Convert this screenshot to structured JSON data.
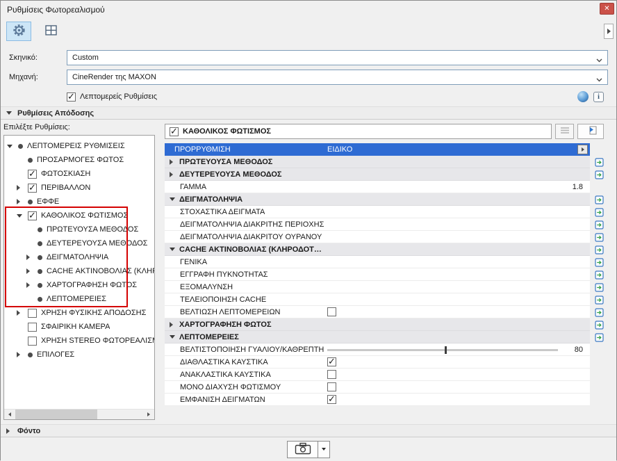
{
  "window": {
    "title": "Ρυθμίσεις Φωτορεαλισμού",
    "close_glyph": "✕"
  },
  "form": {
    "scene_label": "Σκηνικό:",
    "scene_value": "Custom",
    "engine_label": "Μηχανή:",
    "engine_value": "CineRender της MAXON",
    "detailed_settings_label": "Λεπτομερείς Ρυθμίσεις",
    "detailed_settings_checked": true
  },
  "sections": {
    "render_settings": {
      "label": "Ρυθμίσεις Απόδοσης",
      "expanded": true
    },
    "background": {
      "label": "Φόντο",
      "expanded": false
    }
  },
  "tree": {
    "caption": "Επιλέξτε Ρυθμίσεις:",
    "items": [
      {
        "label": "ΛΕΠΤΟΜΕΡΕΙΣ ΡΥΘΜΙΣΕΙΣ",
        "depth": 0,
        "expander": "expanded",
        "marker": "bullet"
      },
      {
        "label": "ΠΡΟΣΑΡΜΟΓΕΣ ΦΩΤΟΣ",
        "depth": 1,
        "expander": "none",
        "marker": "bullet"
      },
      {
        "label": "ΦΩΤΟΣΚΙΑΣΗ",
        "depth": 1,
        "expander": "none",
        "marker": "checkbox",
        "checked": true
      },
      {
        "label": "ΠΕΡΙΒΑΛΛΟΝ",
        "depth": 1,
        "expander": "collapsed",
        "marker": "checkbox",
        "checked": true
      },
      {
        "label": "ΕΦΦΕ",
        "depth": 1,
        "expander": "collapsed",
        "marker": "bullet"
      },
      {
        "label": "ΚΑΘΟΛΙΚΟΣ ΦΩΤΙΣΜΟΣ",
        "depth": 1,
        "expander": "expanded",
        "marker": "checkbox",
        "checked": true,
        "highlighted": true
      },
      {
        "label": "ΠΡΩΤΕΥΟΥΣΑ ΜΕΘΟΔΟΣ",
        "depth": 2,
        "expander": "none",
        "marker": "bullet",
        "highlighted": true
      },
      {
        "label": "ΔΕΥΤΕΡΕΥΟΥΣΑ ΜΕΘΟΔΟΣ",
        "depth": 2,
        "expander": "none",
        "marker": "bullet",
        "highlighted": true
      },
      {
        "label": "ΔΕΙΓΜΑΤΟΛΗΨΙΑ",
        "depth": 2,
        "expander": "collapsed",
        "marker": "bullet",
        "highlighted": true
      },
      {
        "label": "CACHE ΑΚΤΙΝΟΒΟΛΙΑΣ (ΚΛΗΡΟ.",
        "depth": 2,
        "expander": "collapsed",
        "marker": "bullet",
        "highlighted": true
      },
      {
        "label": "ΧΑΡΤΟΓΡΑΦΗΣΗ ΦΩΤΟΣ",
        "depth": 2,
        "expander": "collapsed",
        "marker": "bullet",
        "highlighted": true
      },
      {
        "label": "ΛΕΠΤΟΜΕΡΕΙΕΣ",
        "depth": 2,
        "expander": "none",
        "marker": "bullet",
        "highlighted": true
      },
      {
        "label": "ΧΡΗΣΗ ΦΥΣΙΚΗΣ ΑΠΟΔΟΣΗΣ",
        "depth": 1,
        "expander": "collapsed",
        "marker": "checkbox",
        "checked": false
      },
      {
        "label": "ΣΦΑΙΡΙΚΗ ΚΑΜΕΡΑ",
        "depth": 1,
        "expander": "none",
        "marker": "checkbox",
        "checked": false
      },
      {
        "label": "ΧΡΗΣΗ STEREO ΦΩΤΟΡΕΑΛΙΣΜΟΥ",
        "depth": 1,
        "expander": "none",
        "marker": "checkbox",
        "checked": false
      },
      {
        "label": "ΕΠΙΛΟΓΕΣ",
        "depth": 1,
        "expander": "collapsed",
        "marker": "bullet"
      }
    ]
  },
  "panel": {
    "title": "ΚΑΘΟΛΙΚΟΣ ΦΩΤΙΣΜΟΣ",
    "title_checked": true,
    "rows": [
      {
        "type": "preset",
        "label": "ΠΡΟΡΡΥΘΜΙΣΗ",
        "value": "ΕΙΔΙΚΟ",
        "selected": true
      },
      {
        "type": "group",
        "label": "ΠΡΩΤΕΥΟΥΣΑ ΜΕΘΟΔΟΣ",
        "expanded": false,
        "link": true
      },
      {
        "type": "group",
        "label": "ΔΕΥΤΕΡΕΥΟΥΣΑ ΜΕΘΟΔΟΣ",
        "expanded": false,
        "link": true
      },
      {
        "type": "value",
        "label": "ΓΑΜΜΑ",
        "value": "1.8"
      },
      {
        "type": "group",
        "label": "ΔΕΙΓΜΑΤΟΛΗΨΙΑ",
        "expanded": true,
        "link": true
      },
      {
        "type": "item",
        "label": "ΣΤΟΧΑΣΤΙΚΑ ΔΕΙΓΜΑΤΑ",
        "link": true
      },
      {
        "type": "item",
        "label": "ΔΕΙΓΜΑΤΟΛΗΨΙΑ ΔΙΑΚΡΙΤΗΣ ΠΕΡΙΟΧΗΣ",
        "link": true
      },
      {
        "type": "item",
        "label": "ΔΕΙΓΜΑΤΟΛΗΨΙΑ ΔΙΑΚΡΙΤΟΥ ΟΥΡΑΝΟΥ",
        "link": true
      },
      {
        "type": "group",
        "label": "CACHE ΑΚΤΙΝΟΒΟΛΙΑΣ (ΚΛΗΡΟΔΟΤ…",
        "expanded": true,
        "link": true
      },
      {
        "type": "item",
        "label": "ΓΕΝΙΚΑ",
        "link": true
      },
      {
        "type": "item",
        "label": "ΕΓΓΡΑΦΗ ΠΥΚΝΟΤΗΤΑΣ",
        "link": true
      },
      {
        "type": "item",
        "label": "ΕΞΟΜΑΛΥΝΣΗ",
        "link": true
      },
      {
        "type": "item",
        "label": "ΤΕΛΕΙΟΠΟΙΗΣΗ CACHE",
        "link": true
      },
      {
        "type": "checkbox",
        "label": "ΒΕΛΤΙΩΣΗ ΛΕΠΤΟΜΕΡΕΙΩΝ",
        "checked": false,
        "link": true
      },
      {
        "type": "group",
        "label": "ΧΑΡΤΟΓΡΑΦΗΣΗ ΦΩΤΟΣ",
        "expanded": false,
        "link": true
      },
      {
        "type": "group",
        "label": "ΛΕΠΤΟΜΕΡΕΙΕΣ",
        "expanded": true,
        "link": true
      },
      {
        "type": "slider",
        "label": "ΒΕΛΤΙΣΤΟΠΟΙΗΣΗ ΓΥΑΛΙΟΥ/ΚΑΘΡΕΠΤΗ",
        "value": "80",
        "percent": 51
      },
      {
        "type": "checkbox",
        "label": "ΔΙΑΘΛΑΣΤΙΚΑ ΚΑΥΣΤΙΚΑ",
        "checked": true
      },
      {
        "type": "checkbox",
        "label": "ΑΝΑΚΛΑΣΤΙΚΑ ΚΑΥΣΤΙΚΑ",
        "checked": false
      },
      {
        "type": "checkbox",
        "label": "ΜΟΝΟ ΔΙΑΧΥΣΗ ΦΩΤΙΣΜΟΥ",
        "checked": false
      },
      {
        "type": "checkbox",
        "label": "ΕΜΦΑΝΙΣΗ ΔΕΙΓΜΑΤΩΝ",
        "checked": true
      }
    ]
  }
}
